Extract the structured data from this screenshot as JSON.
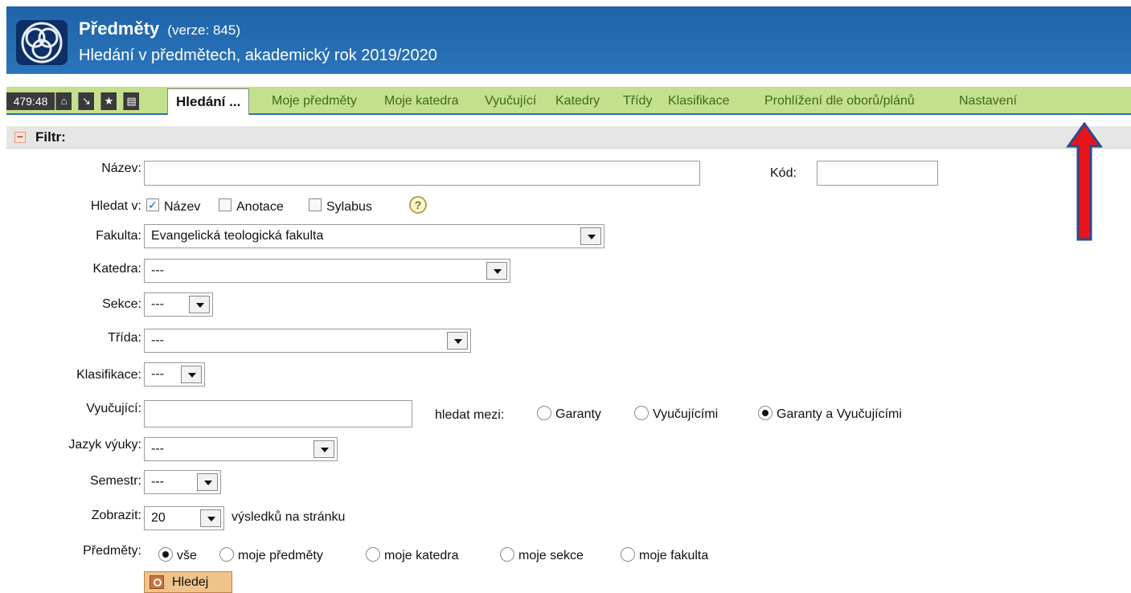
{
  "header": {
    "title": "Předměty",
    "version": "(verze: 845)",
    "subtitle": "Hledání v předmětech, akademický rok 2019/2020"
  },
  "toolbar": {
    "clock": "479:48",
    "home_icon": "⌂",
    "login_icon": "↘",
    "favorite_icon": "★",
    "print_icon": "▤"
  },
  "tabs": {
    "active": "Hledání ...",
    "items": [
      "Moje předměty",
      "Moje katedra",
      "Vyučující",
      "Katedry",
      "Třídy",
      "Klasifikace",
      "Prohlížení dle oborů/plánů",
      "Nastavení"
    ]
  },
  "filter": {
    "toggle": "−",
    "title": "Filtr:",
    "nazev_label": "Název:",
    "nazev_value": "",
    "kod_label": "Kód:",
    "kod_value": "",
    "hledat_label": "Hledat v:",
    "hledat_options": [
      "Název",
      "Anotace",
      "Sylabus"
    ],
    "hledat_checked": [
      true,
      false,
      false
    ],
    "help_icon": "?",
    "fakulta_label": "Fakulta:",
    "fakulta_value": "Evangelická teologická fakulta",
    "katedra_label": "Katedra:",
    "katedra_value": "---",
    "sekce_label": "Sekce:",
    "sekce_value": "---",
    "trida_label": "Třída:",
    "trida_value": "---",
    "klasifikace_label": "Klasifikace:",
    "klasifikace_value": "---",
    "vyucujici_label": "Vyučující:",
    "vyucujici_value": "",
    "hledat_mezi_label": "hledat mezi:",
    "hledat_mezi_options": [
      "Garanty",
      "Vyučujícími",
      "Garanty a Vyučujícími"
    ],
    "hledat_mezi_selected": 2,
    "jazyk_label": "Jazyk výuky:",
    "jazyk_value": "---",
    "semestr_label": "Semestr:",
    "semestr_value": "---",
    "zobrazit_label": "Zobrazit:",
    "zobrazit_value": "20",
    "zobrazit_suffix": "výsledků na stránku",
    "predmety_label": "Předměty:",
    "predmety_options": [
      "vše",
      "moje předměty",
      "moje katedra",
      "moje sekce",
      "moje fakulta"
    ],
    "predmety_selected": 0,
    "search_button": "Hledej"
  },
  "colors": {
    "header_bg": "#2a74bb",
    "tabbar_bg": "#c4e08c",
    "annotation_arrow": "#e8141c"
  }
}
